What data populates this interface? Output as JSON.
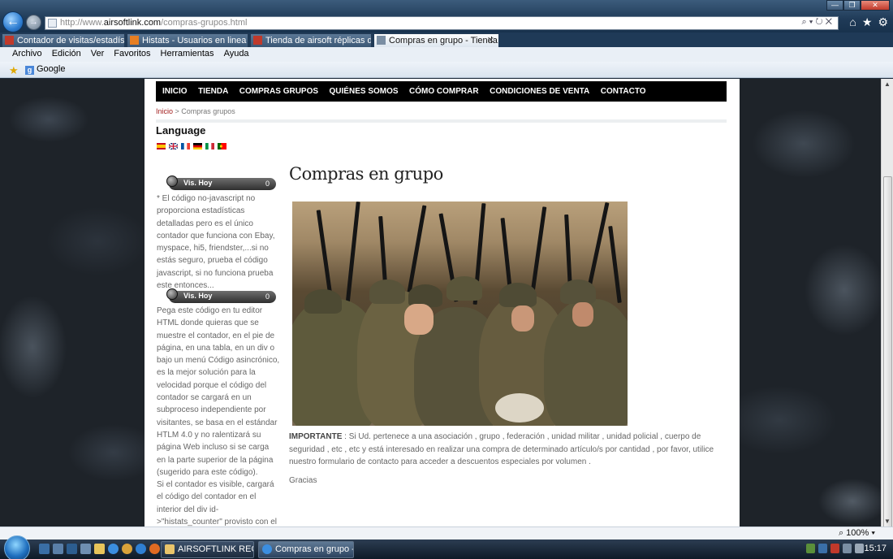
{
  "browser": {
    "url_prefix": "http://www.",
    "url_domain": "airsoftlink.com",
    "url_path": "/compras-grupos.html",
    "tabs": [
      {
        "label": "Contador de visitas/estadística...",
        "active": false
      },
      {
        "label": "Histats - Usuarios en linea > W...",
        "active": false
      },
      {
        "label": "Tienda de airsoft réplicas de air...",
        "active": false
      },
      {
        "label": "Compras en grupo - Tienda...",
        "active": true
      }
    ],
    "menu": [
      "Archivo",
      "Edición",
      "Ver",
      "Favoritos",
      "Herramientas",
      "Ayuda"
    ],
    "favorites": [
      "Google"
    ],
    "zoom": "100%"
  },
  "site": {
    "nav": [
      "INICIO",
      "TIENDA",
      "COMPRAS GRUPOS",
      "QUIÉNES SOMOS",
      "CÓMO COMPRAR",
      "CONDICIONES DE VENTA",
      "CONTACTO"
    ],
    "breadcrumb": {
      "home": "Inicio",
      "separator": " > ",
      "current": "Compras grupos"
    },
    "language_title": "Language",
    "languages": [
      "es",
      "en",
      "fr",
      "de",
      "it",
      "pt"
    ],
    "counter1": {
      "label": "Vis. Hoy",
      "value": "0"
    },
    "sidebar_text1": "* El código no-javascript no proporciona estadísticas detalladas pero es el único contador que funciona con Ebay, myspace, hi5, friendster,...si no estás seguro, prueba el código javascript, si no funciona prueba este entonces...",
    "counter2": {
      "label": "Vis. Hoy",
      "value": "0"
    },
    "sidebar_text2": " Pega este código en tu editor HTML donde quieras que se muestre el contador, en el pie de página, en una tabla, en un div o bajo un menú Código asincrónico, es la mejor solución para la velocidad porque el código del contador se cargará en un subproceso independiente por visitantes, se basa en el estándar HTLM 4.0 y no ralentizará su página Web incluso si se carga en la parte superior de la página (sugerido para este código).",
    "sidebar_text3": "Si el contador es visible, cargará el código del contador en el interior del div id->\"histats_counter\" provisto con el código.",
    "page_title": "Compras en grupo",
    "important_label": "IMPORTANTE",
    "important_text": " : Si Ud. pertenece a una asociación , grupo , federación , unidad militar , unidad policial , cuerpo de seguridad , etc , etc  y está interesado en realizar una compra de determinado artículo/s por cantidad , por favor, utilice nuestro formulario de contacto para acceder a descuentos especiales por volumen .",
    "thanks": "Gracias"
  },
  "taskbar": {
    "buttons": [
      {
        "label": "AIRSOFTLINK RECIB...",
        "active": false
      },
      {
        "label": "Compras en grupo -...",
        "active": true
      }
    ],
    "clock": "15:17"
  },
  "colors": {
    "nav_bg": "#000000",
    "breadcrumb_link": "#a3201f",
    "body_text": "#666666"
  }
}
